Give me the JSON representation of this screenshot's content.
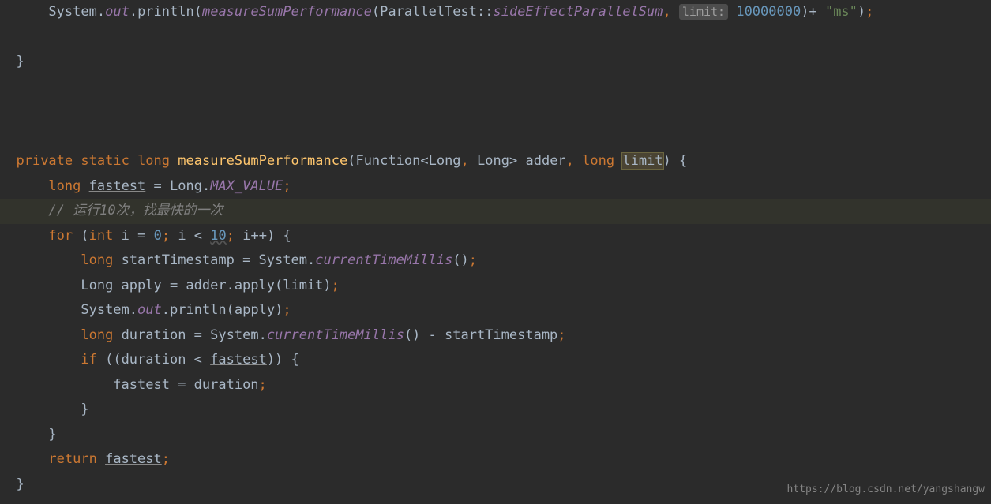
{
  "line1": {
    "prefix_space": "      ",
    "system": "System",
    "dot1": ".",
    "out": "out",
    "dot2": ".",
    "println": "println",
    "paren_open": "(",
    "measure": "measureSumPerformance",
    "paren_open2": "(",
    "parallel_test": "ParallelTest",
    "colons": "::",
    "side_effect": "sideEffectParallelSum",
    "comma": ", ",
    "hint": "limit:",
    "space": " ",
    "num": "10000000",
    "paren_close": ")",
    "plus": "+ ",
    "str": "\"ms\"",
    "paren_close2": ")",
    "semi": ";"
  },
  "line_brace_close": "  }",
  "line_method_sig": {
    "indent": "  ",
    "private": "private",
    "space1": " ",
    "static": "static",
    "space2": " ",
    "long": "long",
    "space3": " ",
    "method_name": "measureSumPerformance",
    "paren_open": "(",
    "function": "Function",
    "lt": "<",
    "long1": "Long",
    "comma": ", ",
    "long2": "Long",
    "gt": ">",
    "space4": " ",
    "adder": "adder",
    "comma2": ", ",
    "long3": "long",
    "space5": " ",
    "limit": "limit",
    "paren_close": ")",
    "brace": " {"
  },
  "line_fastest_decl": {
    "indent": "      ",
    "long": "long",
    "space1": " ",
    "fastest": "fastest",
    "eq": " = ",
    "long_class": "Long",
    "dot": ".",
    "max_value": "MAX_VALUE",
    "semi": ";"
  },
  "line_comment": {
    "indent": "      ",
    "text": "// 运行10次，找最快的一次"
  },
  "line_for": {
    "indent": "      ",
    "for": "for",
    "space": " ",
    "paren_open": "(",
    "int": "int",
    "space2": " ",
    "i": "i",
    "eq": " = ",
    "zero": "0",
    "semi1": "; ",
    "i2": "i",
    "lt": " < ",
    "ten": "10",
    "semi2": "; ",
    "i3": "i",
    "pp": "++",
    "paren_close": ")",
    "brace": " {"
  },
  "line_start_ts": {
    "indent": "          ",
    "long": "long",
    "space": " ",
    "var": "startTimestamp = System",
    "dot": ".",
    "method": "currentTimeMillis",
    "parens": "()",
    "semi": ";"
  },
  "line_apply": {
    "indent": "          ",
    "long_class": "Long apply = adder.apply(limit)",
    "semi": ";"
  },
  "line_println": {
    "indent": "          ",
    "system": "System",
    "dot1": ".",
    "out": "out",
    "dot2": ".",
    "println": "println",
    "parens": "(apply)",
    "semi": ";"
  },
  "line_duration": {
    "indent": "          ",
    "long": "long",
    "space": " ",
    "rest": "duration = System",
    "dot": ".",
    "method": "currentTimeMillis",
    "parens": "()",
    "minus": " - startTimestamp",
    "semi": ";"
  },
  "line_if": {
    "indent": "          ",
    "if": "if",
    "space": " ",
    "cond_open": "((duration < ",
    "fastest": "fastest",
    "cond_close": "))",
    "brace": " {"
  },
  "line_assign": {
    "indent": "              ",
    "fastest": "fastest",
    "rest": " = duration",
    "semi": ";"
  },
  "line_brace_close2": "          }",
  "line_brace_close3": "      }",
  "line_return": {
    "indent": "      ",
    "return": "return",
    "space": " ",
    "fastest": "fastest",
    "semi": ";"
  },
  "line_brace_close4": "  }",
  "watermark": "https://blog.csdn.net/yangshangw"
}
